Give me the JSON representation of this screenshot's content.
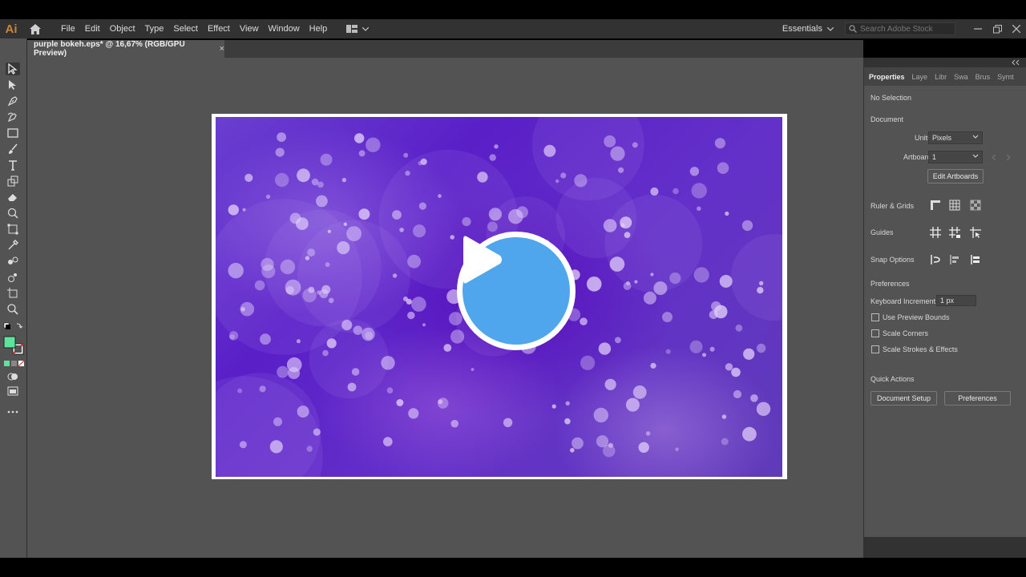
{
  "app": {
    "logo": "Ai"
  },
  "menu": [
    "File",
    "Edit",
    "Object",
    "Type",
    "Select",
    "Effect",
    "View",
    "Window",
    "Help"
  ],
  "workspace": {
    "label": "Essentials"
  },
  "stock_search": {
    "placeholder": "Search Adobe Stock"
  },
  "document_tab": {
    "title": "purple bokeh.eps* @ 16,67% (RGB/GPU Preview)",
    "close": "×"
  },
  "panel": {
    "tabs": [
      "Properties",
      "Laye",
      "Libr",
      "Swa",
      "Brus",
      "Symt"
    ],
    "no_selection": "No Selection",
    "document_section": "Document",
    "units_label": "Units:",
    "units_value": "Pixels",
    "artboard_label": "Artboard:",
    "artboard_value": "1",
    "edit_artboards": "Edit Artboards",
    "ruler_grids": "Ruler & Grids",
    "guides": "Guides",
    "snap_options": "Snap Options",
    "preferences_section": "Preferences",
    "keyboard_increment_label": "Keyboard Increment:",
    "keyboard_increment_value": "1 px",
    "checkboxes": [
      "Use Preview Bounds",
      "Scale Corners",
      "Scale Strokes & Effects"
    ],
    "quick_actions": "Quick Actions",
    "document_setup": "Document Setup",
    "preferences_button": "Preferences"
  },
  "colors": {
    "fill": "#5ce39c",
    "play_button": "#4fa6ec",
    "ui_dark": "#323232",
    "ui_mid": "#535353"
  }
}
